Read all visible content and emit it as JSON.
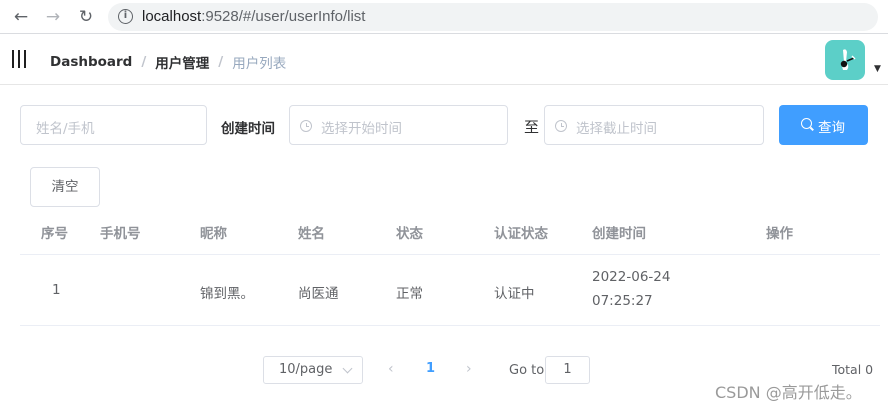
{
  "browser": {
    "url_host": "localhost",
    "url_path": ":9528/#/user/userInfo/list",
    "info_glyph": "i"
  },
  "header": {
    "breadcrumb": [
      "Dashboard",
      "用户管理",
      "用户列表"
    ],
    "separator": "/"
  },
  "search": {
    "name_placeholder": "姓名/手机",
    "created_label": "创建时间",
    "start_placeholder": "选择开始时间",
    "to_label": "至",
    "end_placeholder": "选择截止时间",
    "query_label": "查询",
    "clear_label": "清空"
  },
  "table": {
    "columns": [
      "序号",
      "手机号",
      "昵称",
      "姓名",
      "状态",
      "认证状态",
      "创建时间",
      "操作"
    ],
    "rows": [
      {
        "index": "1",
        "phone": "",
        "nickname": "锦到黑。",
        "name": "尚医通",
        "status": "正常",
        "auth_status": "认证中",
        "created_date": "2022-06-24",
        "created_time": "07:25:27",
        "actions": ""
      }
    ]
  },
  "pagination": {
    "page_size": "10/page",
    "prev": "‹",
    "current": "1",
    "next": "›",
    "goto_label": "Go to",
    "goto_value": "1",
    "total": "Total 0"
  },
  "watermark": "CSDN @高开低走。",
  "colors": {
    "primary": "#409eff",
    "avatar_bg": "#5ccfc8"
  },
  "icons": [
    "back-arrow-icon",
    "forward-arrow-icon",
    "reload-icon",
    "info-icon",
    "hamburger-icon",
    "clock-icon",
    "search-icon",
    "chevron-down-icon"
  ]
}
